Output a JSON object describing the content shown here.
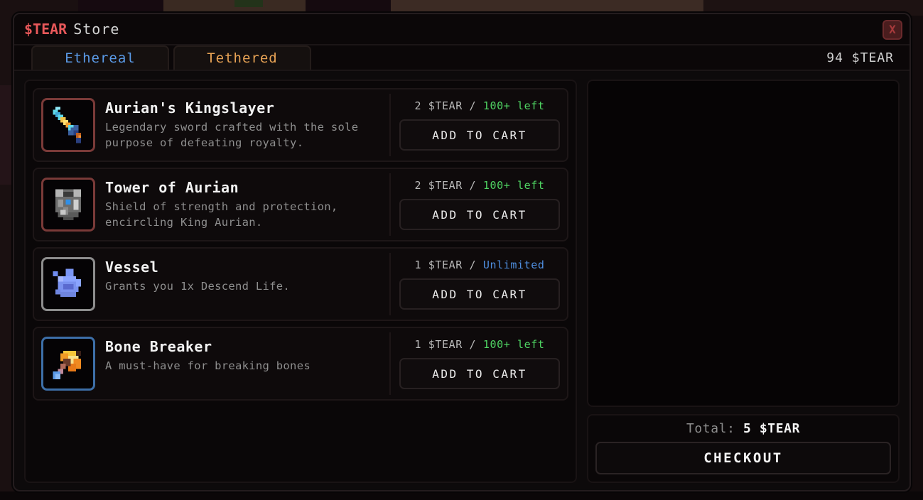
{
  "window": {
    "title_brand": "$TEAR",
    "title_word": "Store",
    "close_label": "X",
    "brand_color": "#e8585a"
  },
  "tabs": [
    {
      "label": "Ethereal",
      "color": "#5b9be8",
      "active": true,
      "name": "tab-ethereal"
    },
    {
      "label": "Tethered",
      "color": "#e8a355",
      "active": false,
      "name": "tab-tethered"
    }
  ],
  "balance": "94 $TEAR",
  "items": [
    {
      "name": "Aurian's Kingslayer",
      "desc": "Legendary sword crafted with the sole purpose of defeating royalty.",
      "price": "2 $TEAR",
      "separator": "/",
      "stock": "100+ left",
      "stock_color": "#4fd463",
      "button": "ADD TO CART",
      "icon": "sword-icon",
      "frame_color": "#7a3a38"
    },
    {
      "name": "Tower of Aurian",
      "desc": "Shield of strength and protection, encircling King Aurian.",
      "price": "2 $TEAR",
      "separator": "/",
      "stock": "100+ left",
      "stock_color": "#4fd463",
      "button": "ADD TO CART",
      "icon": "shield-icon",
      "frame_color": "#7a3a38"
    },
    {
      "name": "Vessel",
      "desc": "Grants you 1x Descend Life.",
      "price": "1 $TEAR",
      "separator": "/",
      "stock": "Unlimited",
      "stock_color": "#4f8fe0",
      "button": "ADD TO CART",
      "icon": "vessel-flame-icon",
      "frame_color": "#8d8d8d"
    },
    {
      "name": "Bone Breaker",
      "desc": "A must-have for breaking bones",
      "price": "1 $TEAR",
      "separator": "/",
      "stock": "100+ left",
      "stock_color": "#4fd463",
      "button": "ADD TO CART",
      "icon": "hammer-icon",
      "frame_color": "#3d6fa8"
    }
  ],
  "cart": {
    "items": [],
    "total_label": "Total:",
    "total_value": "5 $TEAR",
    "checkout_label": "CHECKOUT"
  }
}
